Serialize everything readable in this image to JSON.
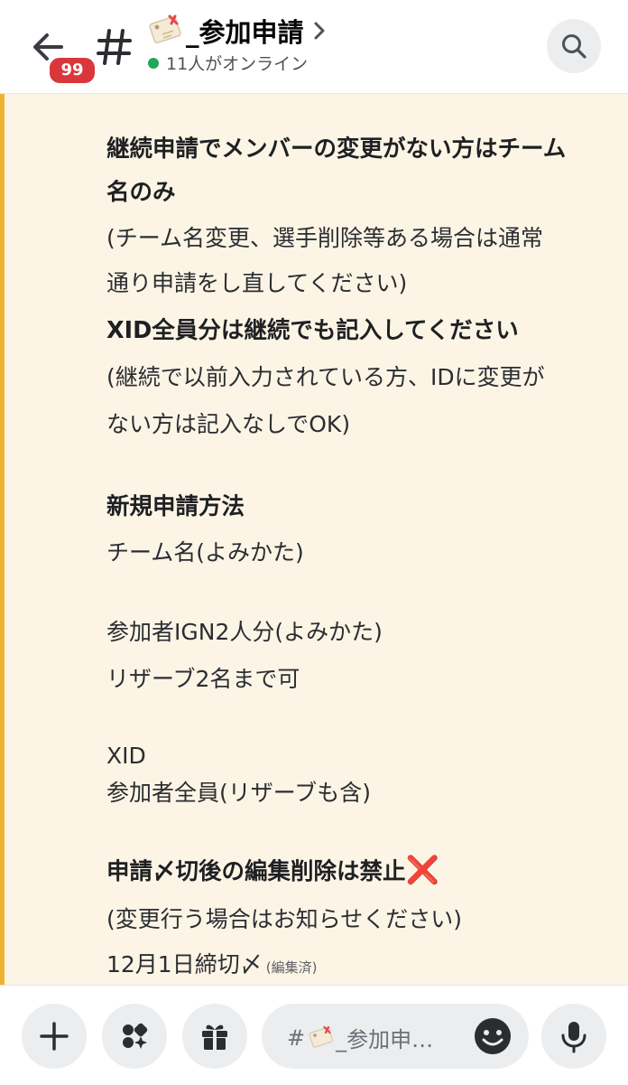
{
  "header": {
    "unread_badge": "99",
    "channel_name": "_参加申請",
    "online_status": "11人がオンライン"
  },
  "message": {
    "lines": [
      "継続申請でメンバーの変更がない方はチーム",
      "名のみ",
      "(チーム名変更、選手削除等ある場合は通常",
      "通り申請をし直してください)",
      "XID全員分は継続でも記入してください",
      "(継続で以前入力されている方、IDに変更が",
      "ない方は記入なしでOK)",
      "新規申請方法",
      "チーム名(よみかた)",
      "参加者IGN2人分(よみかた)",
      "リザーブ2名まで可",
      "XID",
      "参加者全員(リザーブも含)",
      "申請〆切後の編集削除は禁止",
      "❌",
      "(変更行う場合はお知らせください)",
      "12月1日締切〆"
    ],
    "edited_label": "(編集済)"
  },
  "composer": {
    "placeholder_hash": "#",
    "placeholder_text": "_参加申…"
  },
  "icons": {
    "back": "back-arrow-icon",
    "hash": "hash-icon",
    "tag": "memo-tag-icon",
    "chevron": "chevron-right-icon",
    "search": "search-icon",
    "plus": "plus-icon",
    "apps": "apps-icon",
    "gift": "gift-icon",
    "emoji": "emoji-icon",
    "mic": "mic-icon"
  },
  "colors": {
    "badge": "#da373c",
    "online_dot": "#23a55a",
    "highlight_bg": "#fcf5e6",
    "highlight_bar": "#f0b132",
    "cross": "#dd2e44"
  }
}
